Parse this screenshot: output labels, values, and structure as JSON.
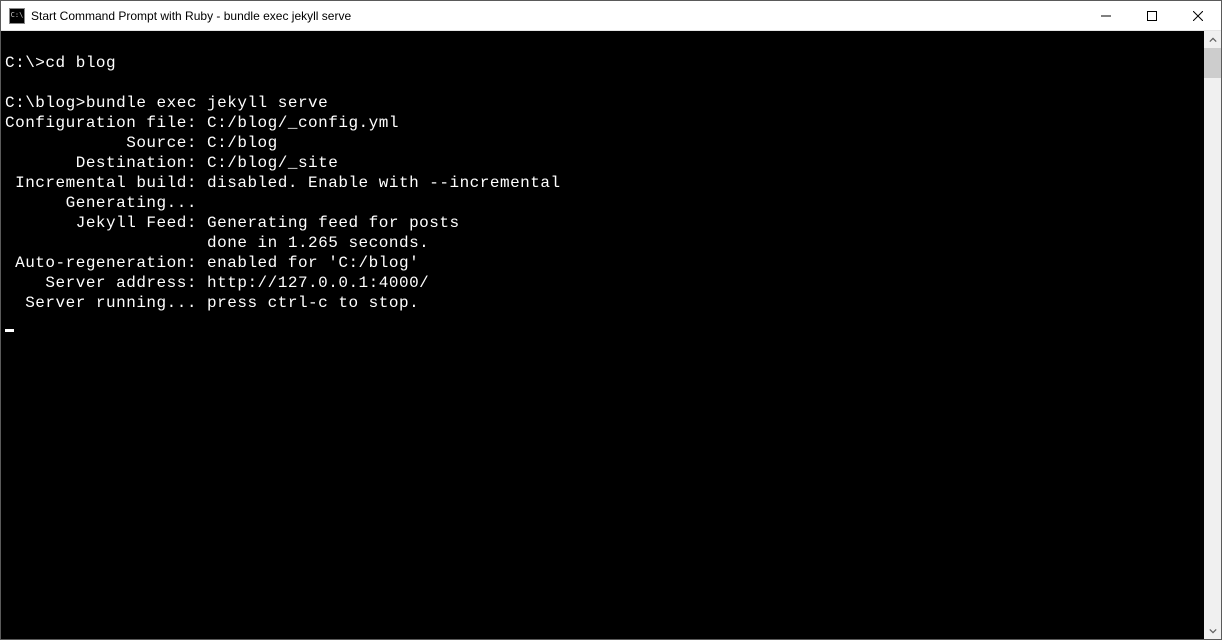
{
  "window": {
    "title": "Start Command Prompt with Ruby - bundle  exec jekyll serve",
    "icon_text": "C:\\"
  },
  "terminal": {
    "lines": [
      "",
      "C:\\>cd blog",
      "",
      "C:\\blog>bundle exec jekyll serve",
      "Configuration file: C:/blog/_config.yml",
      "            Source: C:/blog",
      "       Destination: C:/blog/_site",
      " Incremental build: disabled. Enable with --incremental",
      "      Generating...",
      "       Jekyll Feed: Generating feed for posts",
      "                    done in 1.265 seconds.",
      " Auto-regeneration: enabled for 'C:/blog'",
      "    Server address: http://127.0.0.1:4000/",
      "  Server running... press ctrl-c to stop."
    ]
  }
}
